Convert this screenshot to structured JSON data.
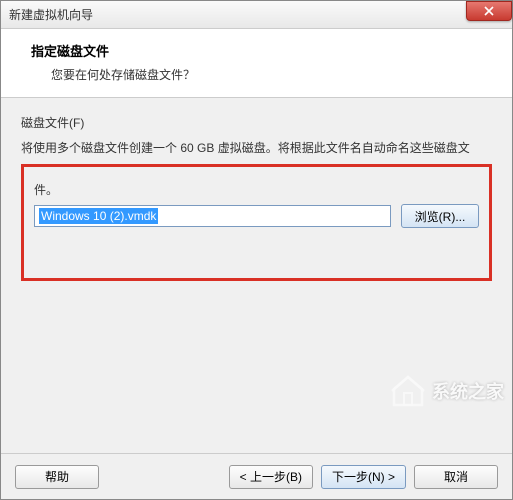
{
  "titlebar": {
    "title": "新建虚拟机向导"
  },
  "header": {
    "title": "指定磁盘文件",
    "subtitle": "您要在何处存储磁盘文件？"
  },
  "content": {
    "section_label": "磁盘文件(F)",
    "description_line1": "将使用多个磁盘文件创建一个 60 GB 虚拟磁盘。将根据此文件名自动命名这些磁盘文",
    "description_line2": "件。",
    "file_input_value": "Windows 10 (2).vmdk",
    "browse_label": "浏览(R)..."
  },
  "footer": {
    "help_label": "帮助",
    "back_label": "< 上一步(B)",
    "next_label": "下一步(N) >",
    "cancel_label": "取消"
  },
  "watermark": {
    "text": "系统之家"
  }
}
